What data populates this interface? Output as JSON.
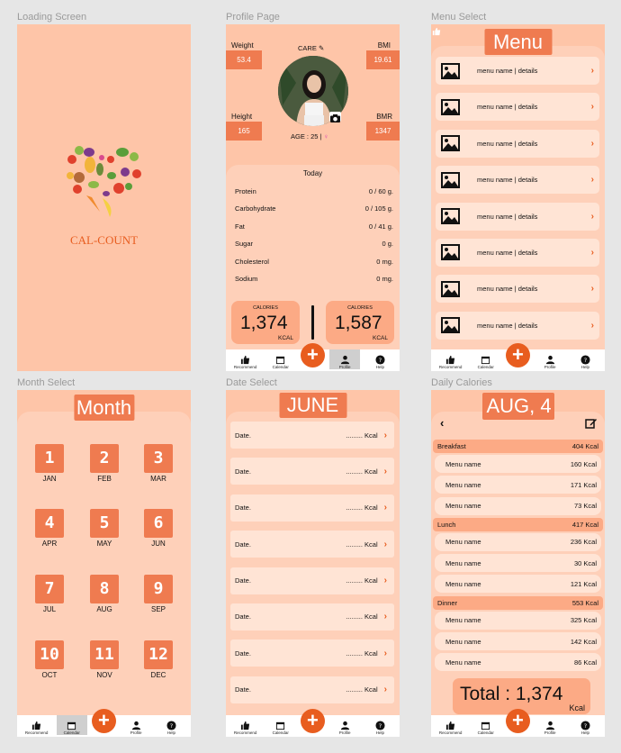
{
  "labels": {
    "loading": "Loading Screen",
    "profile": "Profile Page",
    "menu": "Menu Select",
    "month": "Month Select",
    "date": "Date Select",
    "daily": "Daily Calories"
  },
  "nav": {
    "recommend": "Recommend",
    "calendar": "Calendar",
    "profile": "Profile",
    "help": "Help",
    "fab": "+",
    "calendar_day": "31"
  },
  "loading": {
    "app_name": "CAL-COUNT"
  },
  "profile": {
    "weight_label": "Weight",
    "weight_value": "53.4",
    "bmi_label": "BMI",
    "bmi_value": "19.61",
    "height_label": "Height",
    "height_value": "165",
    "bmr_label": "BMR",
    "bmr_value": "1347",
    "care": "CARE",
    "age": "AGE : 25 |",
    "today": "Today",
    "nutrients": [
      {
        "name": "Protein",
        "value": "0 / 60 g."
      },
      {
        "name": "Carbohydrate",
        "value": "0 / 105 g."
      },
      {
        "name": "Fat",
        "value": "0 / 41 g."
      },
      {
        "name": "Sugar",
        "value": "0 g."
      },
      {
        "name": "Cholesterol",
        "value": "0 mg."
      },
      {
        "name": "Sodium",
        "value": "0 mg."
      }
    ],
    "cal_left_label": "CALORIES",
    "cal_left_value": "1,374",
    "cal_left_unit": "KCAL",
    "cal_right_label": "CALORIES",
    "cal_right_value": "1,587",
    "cal_right_unit": "KCAL"
  },
  "menu": {
    "title": "Menu",
    "items": [
      "menu name | details",
      "menu name | details",
      "menu name | details",
      "menu name | details",
      "menu name | details",
      "menu name | details",
      "menu name | details",
      "menu name | details"
    ]
  },
  "month": {
    "title": "Month",
    "months": [
      {
        "num": "1",
        "name": "JAN"
      },
      {
        "num": "2",
        "name": "FEB"
      },
      {
        "num": "3",
        "name": "MAR"
      },
      {
        "num": "4",
        "name": "APR"
      },
      {
        "num": "5",
        "name": "MAY"
      },
      {
        "num": "6",
        "name": "JUN"
      },
      {
        "num": "7",
        "name": "JUL"
      },
      {
        "num": "8",
        "name": "AUG"
      },
      {
        "num": "9",
        "name": "SEP"
      },
      {
        "num": "10",
        "name": "OCT"
      },
      {
        "num": "11",
        "name": "NOV"
      },
      {
        "num": "12",
        "name": "DEC"
      }
    ]
  },
  "date": {
    "title": "JUNE",
    "rows": [
      {
        "label": "Date.",
        "value": "......... Kcal"
      },
      {
        "label": "Date.",
        "value": "......... Kcal"
      },
      {
        "label": "Date.",
        "value": "......... Kcal"
      },
      {
        "label": "Date.",
        "value": "......... Kcal"
      },
      {
        "label": "Date.",
        "value": "......... Kcal"
      },
      {
        "label": "Date.",
        "value": "......... Kcal"
      },
      {
        "label": "Date.",
        "value": "......... Kcal"
      },
      {
        "label": "Date.",
        "value": "......... Kcal"
      }
    ]
  },
  "daily": {
    "title": "AUG, 4",
    "meals": [
      {
        "name": "Breakfast",
        "total": "404 Kcal",
        "items": [
          {
            "name": "Menu name",
            "kcal": "160 Kcal"
          },
          {
            "name": "Menu name",
            "kcal": "171 Kcal"
          },
          {
            "name": "Menu name",
            "kcal": "73 Kcal"
          }
        ]
      },
      {
        "name": "Lunch",
        "total": "417 Kcal",
        "items": [
          {
            "name": "Menu name",
            "kcal": "236 Kcal"
          },
          {
            "name": "Menu name",
            "kcal": "30 Kcal"
          },
          {
            "name": "Menu name",
            "kcal": "121 Kcal"
          }
        ]
      },
      {
        "name": "Dinner",
        "total": "553 Kcal",
        "items": [
          {
            "name": "Menu name",
            "kcal": "325 Kcal"
          },
          {
            "name": "Menu name",
            "kcal": "142 Kcal"
          },
          {
            "name": "Menu name",
            "kcal": "86 Kcal"
          }
        ]
      }
    ],
    "total": "Total : 1,374",
    "total_unit": "Kcal"
  },
  "colors": {
    "bg": "#fec5a8",
    "panel": "#fed0b9",
    "accent": "#ef7b50",
    "fab": "#e85d1f"
  }
}
